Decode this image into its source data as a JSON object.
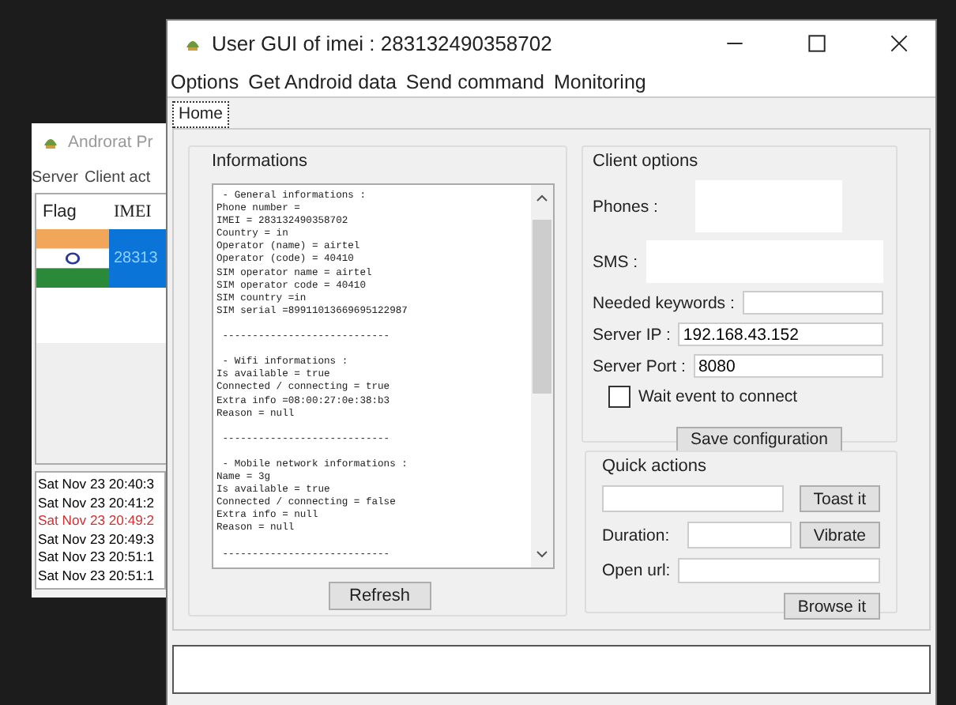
{
  "back_window": {
    "title": "Androrat Pr",
    "menu": [
      "Server",
      "Client act"
    ],
    "table": {
      "columns": [
        "Flag",
        "IMEI"
      ],
      "rows": [
        {
          "imei": "28313",
          "selected": true
        }
      ]
    },
    "log": [
      {
        "text": "Sat Nov 23 20:40:3",
        "color": "#000000"
      },
      {
        "text": "Sat Nov 23 20:41:2",
        "color": "#000000"
      },
      {
        "text": "Sat Nov 23 20:49:2",
        "color": "#d03030"
      },
      {
        "text": "Sat Nov 23 20:49:3",
        "color": "#000000"
      },
      {
        "text": "Sat Nov 23 20:51:1",
        "color": "#000000"
      },
      {
        "text": "Sat Nov 23 20:51:1",
        "color": "#000000"
      }
    ]
  },
  "window": {
    "title": "User GUI of imei : 283132490358702",
    "menu": [
      "Options",
      "Get Android data",
      "Send command",
      "Monitoring"
    ],
    "tabs": [
      {
        "label": "Home",
        "selected": true
      }
    ],
    "informations": {
      "title": "Informations",
      "text": " - General informations :\nPhone number =\nIMEI = 283132490358702\nCountry = in\nOperator (name) = airtel\nOperator (code) = 40410\nSIM operator name = airtel\nSIM operator code = 40410\nSIM country =in\nSIM serial =89911013669695122987\n\n ----------------------------\n\n - Wifi informations :\nIs available = true\nConnected / connecting = true\nExtra info =08:00:27:0e:38:b3\nReason = null\n\n ----------------------------\n\n - Mobile network informations :\nName = 3g\nIs available = true\nConnected / connecting = false\nExtra info = null\nReason = null\n\n ----------------------------",
      "button": "Refresh"
    },
    "client_options": {
      "title": "Client options",
      "phones_label": "Phones :",
      "sms_label": "SMS :",
      "keywords_label": "Needed keywords :",
      "server_ip_label": "Server IP :",
      "server_ip": "192.168.43.152",
      "server_port_label": "Server Port :",
      "server_port": "8080",
      "wait_event": {
        "label": "Wait event to connect",
        "checked": false
      },
      "save_button": "Save configuration"
    },
    "quick_actions": {
      "title": "Quick actions",
      "toast_button": "Toast it",
      "duration_label": "Duration:",
      "vibrate_button": "Vibrate",
      "url_label": "Open url:",
      "browse_button": "Browse it"
    }
  }
}
